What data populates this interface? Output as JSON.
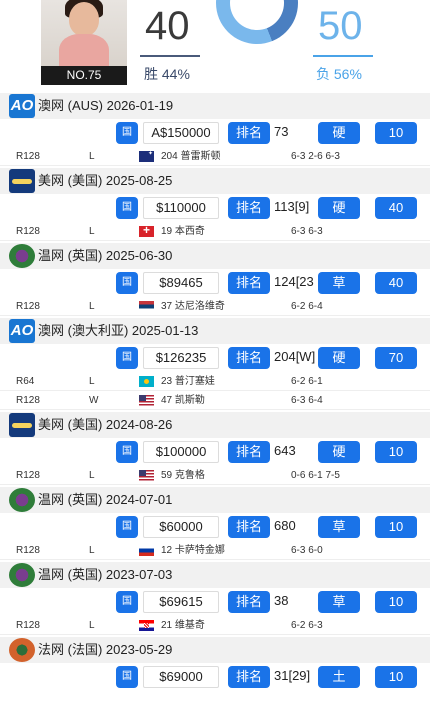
{
  "player": {
    "rank_label": "NO.75",
    "wins": "40",
    "losses": "50",
    "win_label": "胜 44%",
    "loss_label": "负 56%",
    "win_fraction": 0.44
  },
  "buttons": {
    "flag_icon_label": "国",
    "rank_label": "排名"
  },
  "colors": {
    "accent_blue": "#1a73e8",
    "header_bg": "#f1f1f1"
  },
  "tournaments": [
    {
      "logo": "ao-logo",
      "title": "澳网 (AUS) 2026-01-19",
      "prize": "A$150000",
      "rank": "73",
      "surface": "硬",
      "points": "10",
      "matches": [
        {
          "round": "R128",
          "result": "L",
          "flag": "flag-au-icon",
          "opponent": "204 普雷斯顿",
          "score": "6-3 2-6 6-3"
        }
      ]
    },
    {
      "logo": "usopen-logo",
      "title": "美网 (美国) 2025-08-25",
      "prize": "$110000",
      "rank": "113[9]",
      "surface": "硬",
      "points": "40",
      "matches": [
        {
          "round": "R128",
          "result": "L",
          "flag": "flag-ch-icon",
          "opponent": "19 本西奇",
          "score": "6-3 6-3"
        }
      ]
    },
    {
      "logo": "wimbledon-logo",
      "title": "温网 (英国) 2025-06-30",
      "prize": "$89465",
      "rank": "124[23",
      "surface": "草",
      "points": "40",
      "matches": [
        {
          "round": "R128",
          "result": "L",
          "flag": "flag-rs-icon",
          "opponent": "37 达尼洛维奇",
          "score": "6-2 6-4"
        }
      ]
    },
    {
      "logo": "ao-logo",
      "title": "澳网 (澳大利亚) 2025-01-13",
      "prize": "$126235",
      "rank": "204[W]",
      "surface": "硬",
      "points": "70",
      "matches": [
        {
          "round": "R64",
          "result": "L",
          "flag": "flag-kz-icon",
          "opponent": "23 普汀塞娃",
          "score": "6-2 6-1"
        },
        {
          "round": "R128",
          "result": "W",
          "flag": "flag-us-icon",
          "opponent": "47 凯斯勒",
          "score": "6-3 6-4"
        }
      ]
    },
    {
      "logo": "usopen-logo",
      "title": "美网 (美国) 2024-08-26",
      "prize": "$100000",
      "rank": "643",
      "surface": "硬",
      "points": "10",
      "matches": [
        {
          "round": "R128",
          "result": "L",
          "flag": "flag-us-icon",
          "opponent": "59 克鲁格",
          "score": "0-6 6-1 7-5"
        }
      ]
    },
    {
      "logo": "wimbledon-logo",
      "title": "温网 (英国) 2024-07-01",
      "prize": "$60000",
      "rank": "680",
      "surface": "草",
      "points": "10",
      "matches": [
        {
          "round": "R128",
          "result": "L",
          "flag": "flag-ru-icon",
          "opponent": "12 卡萨特金娜",
          "score": "6-3 6-0"
        }
      ]
    },
    {
      "logo": "wimbledon-logo",
      "title": "温网 (英国) 2023-07-03",
      "prize": "$69615",
      "rank": "38",
      "surface": "草",
      "points": "10",
      "matches": [
        {
          "round": "R128",
          "result": "L",
          "flag": "flag-hr-icon",
          "opponent": "21 维基奇",
          "score": "6-2 6-3"
        }
      ]
    },
    {
      "logo": "rolandgarros-logo",
      "title": "法网 (法国) 2023-05-29",
      "prize": "$69000",
      "rank": "31[29]",
      "surface": "土",
      "points": "10",
      "matches": []
    }
  ]
}
